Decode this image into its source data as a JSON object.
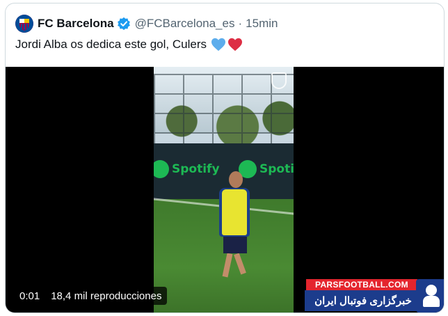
{
  "tweet": {
    "display_name": "FC Barcelona",
    "handle": "@FCBarcelona_es",
    "separator": "·",
    "time": "15min",
    "text": "Jordi Alba os dedica este gol, Culers",
    "emoji": [
      "blue-heart",
      "red-heart"
    ]
  },
  "video": {
    "current_time": "0:01",
    "view_count": "18,4 mil reproducciones",
    "banner_text": [
      "Spotify",
      "Spotify"
    ]
  },
  "watermark": {
    "site": "PARSFOOTBALL.COM",
    "tagline": "خبرگزاری فوتبال ایران"
  },
  "colors": {
    "verified": "#1d9bf0",
    "spotify": "#1db954",
    "barca_blue": "#004d98",
    "barca_red": "#a50044",
    "watermark_red": "#e4252e",
    "watermark_blue": "#1c3c8c"
  }
}
